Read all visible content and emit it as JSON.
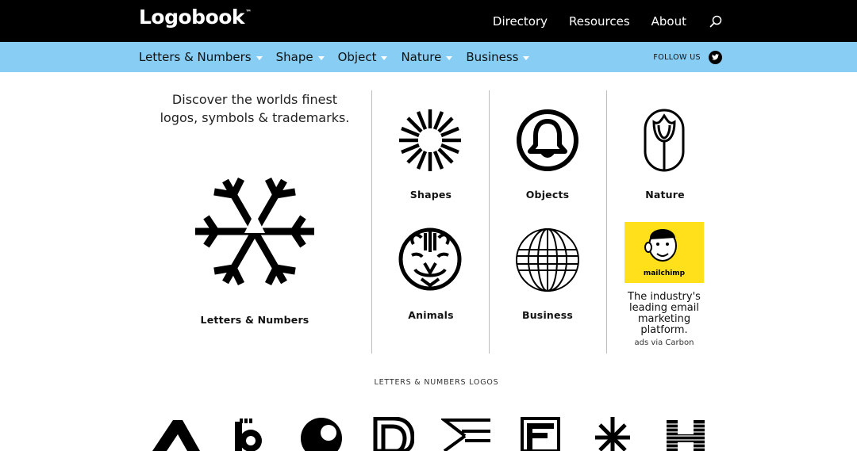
{
  "header": {
    "logo_text": "Logobook",
    "logo_tm": "™",
    "nav": [
      "Directory",
      "Resources",
      "About"
    ],
    "search_icon": "search-icon"
  },
  "subnav": {
    "items": [
      "Letters & Numbers",
      "Shape",
      "Object",
      "Nature",
      "Business"
    ],
    "follow_label": "FOLLOW US",
    "follow_icon": "twitter-icon"
  },
  "hero": {
    "tagline_line1": "Discover the worlds finest",
    "tagline_line2": "logos, symbols & trademarks.",
    "feature_label": "Letters & Numbers"
  },
  "categories": [
    {
      "label": "Shapes",
      "icon": "sunburst-icon"
    },
    {
      "label": "Objects",
      "icon": "bell-icon"
    },
    {
      "label": "Nature",
      "icon": "tulip-icon"
    },
    {
      "label": "Animals",
      "icon": "lion-icon"
    },
    {
      "label": "Business",
      "icon": "globe-icon"
    }
  ],
  "ad": {
    "brand": "mailchimp",
    "text": "The industry's leading email marketing platform.",
    "via": "ads via Carbon"
  },
  "section": {
    "title": "LETTERS & NUMBERS LOGOS"
  },
  "colors": {
    "topbar": "#000000",
    "subbar": "#87cdf4",
    "ad_yellow": "#ffe01b"
  }
}
